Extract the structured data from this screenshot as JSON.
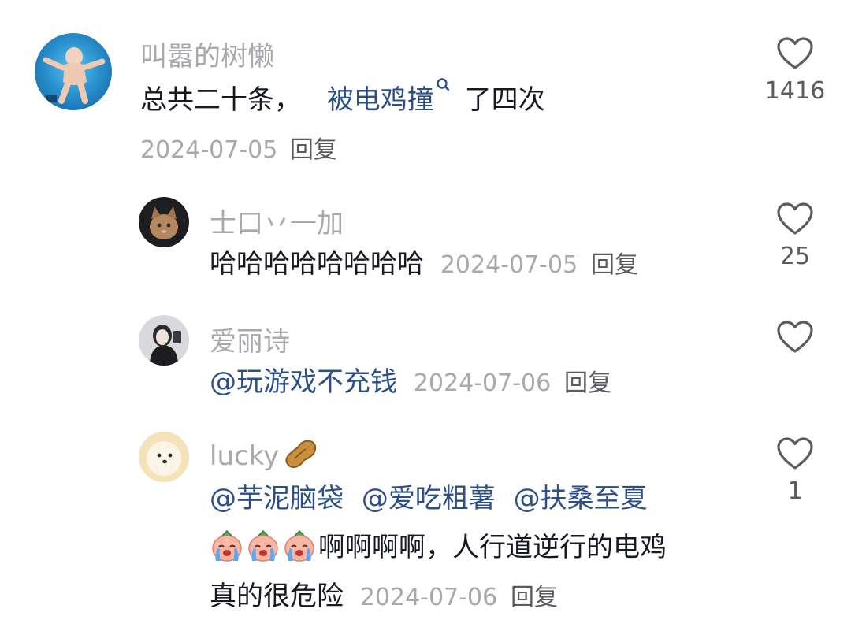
{
  "comments": [
    {
      "username": "叫嚣的树懒",
      "text_prefix": "总共二十条，",
      "link_text": "被电鸡撞",
      "text_suffix": "了四次",
      "date": "2024-07-05",
      "reply_label": "回复",
      "likes": "1416",
      "avatar_icon": "baby-swimming-avatar"
    },
    {
      "username": "士口丷一加",
      "text": "哈哈哈哈哈哈哈哈",
      "date": "2024-07-05",
      "reply_label": "回复",
      "likes": "25",
      "avatar_icon": "cat-avatar"
    },
    {
      "username": "爱丽诗",
      "mention": "@玩游戏不充钱",
      "date": "2024-07-06",
      "reply_label": "回复",
      "likes": "",
      "avatar_icon": "girl-avatar"
    },
    {
      "username": "lucky",
      "mentions": [
        "@芋泥脑袋",
        "@爱吃粗薯",
        "@扶桑至夏"
      ],
      "line2": "啊啊啊啊，人行道逆行的电鸡",
      "line3": "真的很危险",
      "date": "2024-07-06",
      "reply_label": "回复",
      "likes": "1",
      "avatar_icon": "dog-avatar",
      "name_emoji": "peanut-emoji",
      "crying_emoji_count": 3
    }
  ],
  "colors": {
    "username": "#a8a9ad",
    "text": "#161823",
    "mention": "#2b4f86",
    "heart_outline": "#5a5b60"
  }
}
